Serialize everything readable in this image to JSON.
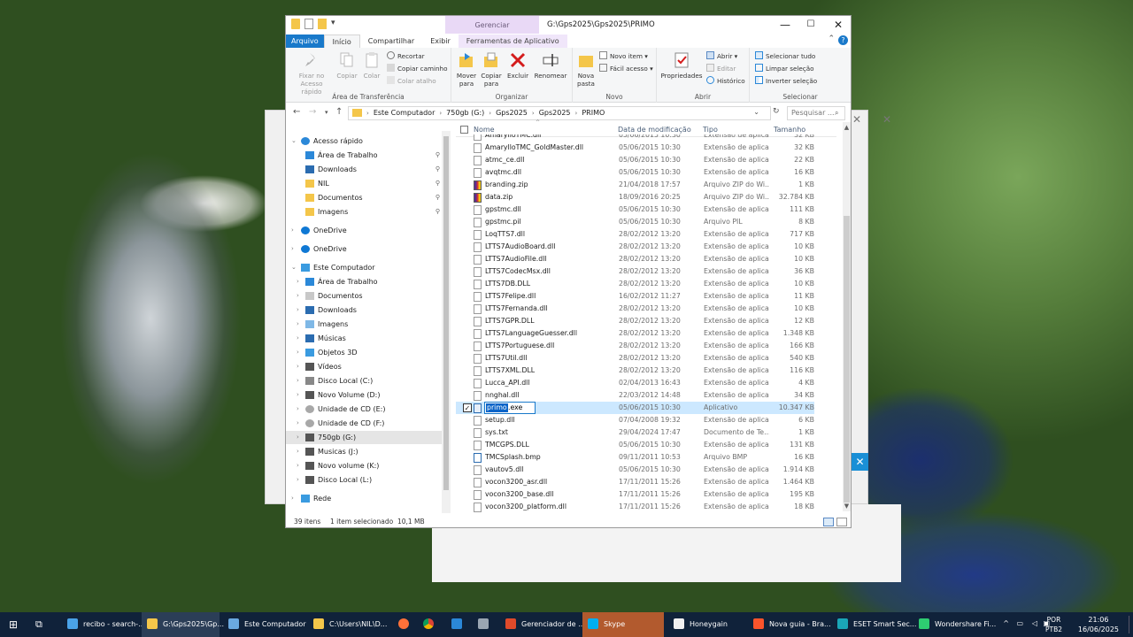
{
  "window": {
    "title": "G:\\Gps2025\\Gps2025\\PRIMO",
    "context_tab": "Gerenciar",
    "minimize": "—",
    "maximize": "☐",
    "close": "✕"
  },
  "tabs": [
    "Arquivo",
    "Início",
    "Compartilhar",
    "Exibir",
    "Ferramentas de Aplicativo"
  ],
  "ribbon": {
    "clipboard": {
      "pin": "Fixar no Acesso rápido",
      "copy": "Copiar",
      "paste": "Colar",
      "cut": "Recortar",
      "copy_path": "Copiar caminho",
      "paste_shortcut": "Colar atalho",
      "group": "Área de Transferência"
    },
    "organize": {
      "move": "Mover para",
      "copyto": "Copiar para",
      "delete": "Excluir",
      "rename": "Renomear",
      "group": "Organizar"
    },
    "new": {
      "folder": "Nova pasta",
      "item": "Novo item",
      "easy": "Fácil acesso",
      "group": "Novo"
    },
    "open": {
      "props": "Propriedades",
      "open": "Abrir",
      "edit": "Editar",
      "history": "Histórico",
      "group": "Abrir"
    },
    "select": {
      "all": "Selecionar tudo",
      "none": "Limpar seleção",
      "invert": "Inverter seleção",
      "group": "Selecionar"
    }
  },
  "address": {
    "crumbs": [
      "Este Computador",
      "750gb (G:)",
      "Gps2025",
      "Gps2025",
      "PRIMO"
    ],
    "search_placeholder": "Pesquisar ..."
  },
  "nav": [
    {
      "label": "Acesso rápido",
      "icon": "star-icon",
      "level": 0,
      "color": "#2b88d8"
    },
    {
      "label": "Área de Trabalho",
      "icon": "desktop-folder-icon",
      "level": 1,
      "pin": true,
      "color": "#2b88d8"
    },
    {
      "label": "Downloads",
      "icon": "download-icon",
      "level": 1,
      "pin": true,
      "color": "#2b6cb0"
    },
    {
      "label": "NIL",
      "icon": "folder-icon",
      "level": 1,
      "pin": true,
      "color": "#f4c64a"
    },
    {
      "label": "Documentos",
      "icon": "documents-icon",
      "level": 1,
      "pin": true,
      "color": "#f4c64a"
    },
    {
      "label": "Imagens",
      "icon": "pictures-icon",
      "level": 1,
      "pin": true,
      "color": "#f4c64a"
    },
    {
      "label": "OneDrive",
      "icon": "cloud-icon",
      "level": 0,
      "color": "#0f78d4"
    },
    {
      "label": "OneDrive",
      "icon": "cloud-icon",
      "level": 0,
      "color": "#0f78d4"
    },
    {
      "label": "Este Computador",
      "icon": "computer-icon",
      "level": 0,
      "color": "#3a9be0"
    },
    {
      "label": "Área de Trabalho",
      "icon": "desktop-folder-icon",
      "level": 1,
      "color": "#2b88d8"
    },
    {
      "label": "Documentos",
      "icon": "documents-icon",
      "level": 1,
      "color": "#c8c8c8"
    },
    {
      "label": "Downloads",
      "icon": "download-icon",
      "level": 1,
      "color": "#2b6cb0"
    },
    {
      "label": "Imagens",
      "icon": "pictures-icon",
      "level": 1,
      "color": "#7fb8e6"
    },
    {
      "label": "Músicas",
      "icon": "music-icon",
      "level": 1,
      "color": "#2b6cb0"
    },
    {
      "label": "Objetos 3D",
      "icon": "objects3d-icon",
      "level": 1,
      "color": "#3a9be0"
    },
    {
      "label": "Vídeos",
      "icon": "videos-icon",
      "level": 1,
      "color": "#555555"
    },
    {
      "label": "Disco Local (C:)",
      "icon": "drive-icon",
      "level": 1,
      "color": "#888888"
    },
    {
      "label": "Novo Volume (D:)",
      "icon": "drive-icon",
      "level": 1,
      "color": "#555555"
    },
    {
      "label": "Unidade de CD (E:)",
      "icon": "cd-icon",
      "level": 1,
      "color": "#a8a8a8"
    },
    {
      "label": "Unidade de CD (F:)",
      "icon": "cd-icon",
      "level": 1,
      "color": "#a8a8a8"
    },
    {
      "label": "750gb (G:)",
      "icon": "drive-icon",
      "level": 1,
      "selected": true,
      "color": "#555555"
    },
    {
      "label": "Musicas (J:)",
      "icon": "drive-icon",
      "level": 1,
      "color": "#555555"
    },
    {
      "label": "Novo volume (K:)",
      "icon": "drive-icon",
      "level": 1,
      "color": "#555555"
    },
    {
      "label": "Disco Local (L:)",
      "icon": "drive-icon",
      "level": 1,
      "color": "#555555"
    },
    {
      "label": "Rede",
      "icon": "network-icon",
      "level": 0,
      "color": "#3a9be0"
    }
  ],
  "columns": [
    "Nome",
    "Data de modificação",
    "Tipo",
    "Tamanho"
  ],
  "files": [
    {
      "name": "AmarylloTMC.dll",
      "date": "05/06/2015 10:30",
      "type": "Extensão de aplica...",
      "size": "32 KB",
      "kind": "dll"
    },
    {
      "name": "AmarylloTMC_GoldMaster.dll",
      "date": "05/06/2015 10:30",
      "type": "Extensão de aplica...",
      "size": "32 KB",
      "kind": "dll"
    },
    {
      "name": "atmc_ce.dll",
      "date": "05/06/2015 10:30",
      "type": "Extensão de aplica...",
      "size": "22 KB",
      "kind": "dll"
    },
    {
      "name": "avqtmc.dll",
      "date": "05/06/2015 10:30",
      "type": "Extensão de aplica...",
      "size": "16 KB",
      "kind": "dll"
    },
    {
      "name": "branding.zip",
      "date": "21/04/2018 17:57",
      "type": "Arquivo ZIP do Wi...",
      "size": "1 KB",
      "kind": "zip"
    },
    {
      "name": "data.zip",
      "date": "18/09/2016 20:25",
      "type": "Arquivo ZIP do Wi...",
      "size": "32.784 KB",
      "kind": "zip"
    },
    {
      "name": "gpstmc.dll",
      "date": "05/06/2015 10:30",
      "type": "Extensão de aplica...",
      "size": "111 KB",
      "kind": "dll"
    },
    {
      "name": "gpstmc.pil",
      "date": "05/06/2015 10:30",
      "type": "Arquivo PIL",
      "size": "8 KB",
      "kind": "file"
    },
    {
      "name": "LoqTTS7.dll",
      "date": "28/02/2012 13:20",
      "type": "Extensão de aplica...",
      "size": "717 KB",
      "kind": "dll"
    },
    {
      "name": "LTTS7AudioBoard.dll",
      "date": "28/02/2012 13:20",
      "type": "Extensão de aplica...",
      "size": "10 KB",
      "kind": "dll"
    },
    {
      "name": "LTTS7AudioFile.dll",
      "date": "28/02/2012 13:20",
      "type": "Extensão de aplica...",
      "size": "10 KB",
      "kind": "dll"
    },
    {
      "name": "LTTS7CodecMsx.dll",
      "date": "28/02/2012 13:20",
      "type": "Extensão de aplica...",
      "size": "36 KB",
      "kind": "dll"
    },
    {
      "name": "LTTS7DB.DLL",
      "date": "28/02/2012 13:20",
      "type": "Extensão de aplica...",
      "size": "10 KB",
      "kind": "dll"
    },
    {
      "name": "LTTS7Felipe.dll",
      "date": "16/02/2012 11:27",
      "type": "Extensão de aplica...",
      "size": "11 KB",
      "kind": "dll"
    },
    {
      "name": "LTTS7Fernanda.dll",
      "date": "28/02/2012 13:20",
      "type": "Extensão de aplica...",
      "size": "10 KB",
      "kind": "dll"
    },
    {
      "name": "LTTS7GPR.DLL",
      "date": "28/02/2012 13:20",
      "type": "Extensão de aplica...",
      "size": "12 KB",
      "kind": "dll"
    },
    {
      "name": "LTTS7LanguageGuesser.dll",
      "date": "28/02/2012 13:20",
      "type": "Extensão de aplica...",
      "size": "1.348 KB",
      "kind": "dll"
    },
    {
      "name": "LTTS7Portuguese.dll",
      "date": "28/02/2012 13:20",
      "type": "Extensão de aplica...",
      "size": "166 KB",
      "kind": "dll"
    },
    {
      "name": "LTTS7Util.dll",
      "date": "28/02/2012 13:20",
      "type": "Extensão de aplica...",
      "size": "540 KB",
      "kind": "dll"
    },
    {
      "name": "LTTS7XML.DLL",
      "date": "28/02/2012 13:20",
      "type": "Extensão de aplica...",
      "size": "116 KB",
      "kind": "dll"
    },
    {
      "name": "Lucca_API.dll",
      "date": "02/04/2013 16:43",
      "type": "Extensão de aplica...",
      "size": "4 KB",
      "kind": "dll"
    },
    {
      "name": "nnghal.dll",
      "date": "22/03/2012 14:48",
      "type": "Extensão de aplica...",
      "size": "34 KB",
      "kind": "dll"
    },
    {
      "name": "primo.exe",
      "date": "05/06/2015 10:30",
      "type": "Aplicativo",
      "size": "10.347 KB",
      "kind": "exe",
      "selected": true
    },
    {
      "name": "setup.dll",
      "date": "07/04/2008 19:32",
      "type": "Extensão de aplica...",
      "size": "6 KB",
      "kind": "dll"
    },
    {
      "name": "sys.txt",
      "date": "29/04/2024 17:47",
      "type": "Documento de Te...",
      "size": "1 KB",
      "kind": "file"
    },
    {
      "name": "TMCGPS.DLL",
      "date": "05/06/2015 10:30",
      "type": "Extensão de aplica...",
      "size": "131 KB",
      "kind": "dll"
    },
    {
      "name": "TMCSplash.bmp",
      "date": "09/11/2011 10:53",
      "type": "Arquivo BMP",
      "size": "16 KB",
      "kind": "bmp"
    },
    {
      "name": "vautov5.dll",
      "date": "05/06/2015 10:30",
      "type": "Extensão de aplica...",
      "size": "1.914 KB",
      "kind": "dll"
    },
    {
      "name": "vocon3200_asr.dll",
      "date": "17/11/2011 15:26",
      "type": "Extensão de aplica...",
      "size": "1.464 KB",
      "kind": "dll"
    },
    {
      "name": "vocon3200_base.dll",
      "date": "17/11/2011 15:26",
      "type": "Extensão de aplica...",
      "size": "195 KB",
      "kind": "dll"
    },
    {
      "name": "vocon3200_platform.dll",
      "date": "17/11/2011 15:26",
      "type": "Extensão de aplica...",
      "size": "18 KB",
      "kind": "dll"
    }
  ],
  "rename": {
    "selected_part": "primo",
    "rest": ".exe"
  },
  "status": {
    "count": "39 itens",
    "selection": "1 item selecionado  10,1 MB"
  },
  "taskbar": {
    "items": [
      {
        "label": "recibo - search-...",
        "color": "#4aa3e8"
      },
      {
        "label": "G:\\Gps2025\\Gp...",
        "color": "#f4c64a",
        "active": true
      },
      {
        "label": "Este Computador",
        "color": "#6aa9e0"
      },
      {
        "label": "C:\\Users\\NIL\\D...",
        "color": "#f4c64a"
      },
      {
        "label": "Gerenciador de ...",
        "color": "#e04a2a"
      },
      {
        "label": "Skype",
        "color": "#00aff0",
        "orange": true
      },
      {
        "label": "Honeygain",
        "color": "#f0f0f0"
      },
      {
        "label": "Nova guia - Bra...",
        "color": "#fb542b"
      },
      {
        "label": "ESET Smart Sec...",
        "color": "#1aa6b7"
      },
      {
        "label": "Wondershare Fi...",
        "color": "#2ecc71"
      }
    ],
    "lang": [
      "POR",
      "PTB2"
    ],
    "time": "21:06",
    "date": "16/06/2025"
  }
}
